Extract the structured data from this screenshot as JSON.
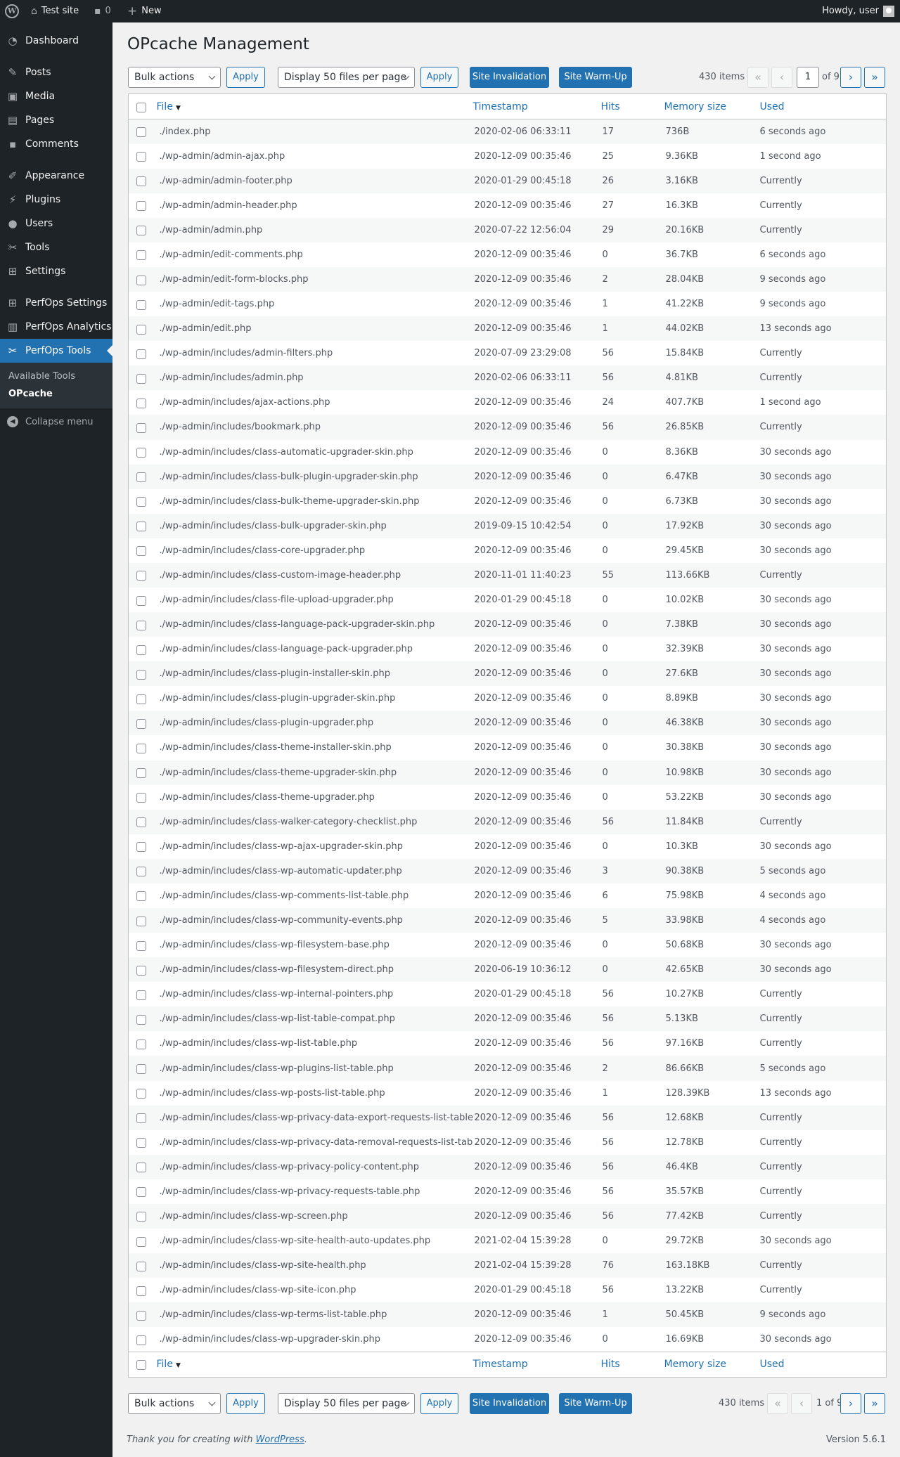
{
  "admin_bar": {
    "site_name": "Test site",
    "comments_count": "0",
    "new_label": "New",
    "howdy": "Howdy, user"
  },
  "sidebar": {
    "items": [
      {
        "label": "Dashboard",
        "icon": "dashboard-icon"
      },
      {
        "label": "Posts",
        "icon": "pin-icon"
      },
      {
        "label": "Media",
        "icon": "media-icon"
      },
      {
        "label": "Pages",
        "icon": "pages-icon"
      },
      {
        "label": "Comments",
        "icon": "comment-icon"
      },
      {
        "label": "Appearance",
        "icon": "brush-icon"
      },
      {
        "label": "Plugins",
        "icon": "plug-icon"
      },
      {
        "label": "Users",
        "icon": "user-icon"
      },
      {
        "label": "Tools",
        "icon": "wrench-icon"
      },
      {
        "label": "Settings",
        "icon": "settings-icon"
      },
      {
        "label": "PerfOps Settings",
        "icon": "settings-icon"
      },
      {
        "label": "PerfOps Analytics",
        "icon": "chart-icon"
      },
      {
        "label": "PerfOps Tools",
        "icon": "wrench-icon"
      }
    ],
    "submenu": [
      "Available Tools",
      "OPcache"
    ],
    "collapse": "Collapse menu"
  },
  "page": {
    "title": "OPcache Management"
  },
  "toolbar": {
    "bulk_actions": "Bulk actions",
    "apply": "Apply",
    "display": "Display 50 files per page",
    "site_invalidation": "Site Invalidation",
    "site_warmup": "Site Warm-Up",
    "items_count": "430 items",
    "current_page": "1",
    "of_pages": "of 9",
    "page_label_bottom": "1 of 9",
    "first": "«",
    "prev": "‹",
    "next": "›",
    "last": "»"
  },
  "columns": {
    "file": "File",
    "timestamp": "Timestamp",
    "hits": "Hits",
    "memory": "Memory size",
    "used": "Used"
  },
  "rows": [
    [
      "./index.php",
      "2020-02-06 06:33:11",
      "17",
      "736B",
      "6 seconds ago"
    ],
    [
      "./wp-admin/admin-ajax.php",
      "2020-12-09 00:35:46",
      "25",
      "9.36KB",
      "1 second ago"
    ],
    [
      "./wp-admin/admin-footer.php",
      "2020-01-29 00:45:18",
      "26",
      "3.16KB",
      "Currently"
    ],
    [
      "./wp-admin/admin-header.php",
      "2020-12-09 00:35:46",
      "27",
      "16.3KB",
      "Currently"
    ],
    [
      "./wp-admin/admin.php",
      "2020-07-22 12:56:04",
      "29",
      "20.16KB",
      "Currently"
    ],
    [
      "./wp-admin/edit-comments.php",
      "2020-12-09 00:35:46",
      "0",
      "36.7KB",
      "6 seconds ago"
    ],
    [
      "./wp-admin/edit-form-blocks.php",
      "2020-12-09 00:35:46",
      "2",
      "28.04KB",
      "9 seconds ago"
    ],
    [
      "./wp-admin/edit-tags.php",
      "2020-12-09 00:35:46",
      "1",
      "41.22KB",
      "9 seconds ago"
    ],
    [
      "./wp-admin/edit.php",
      "2020-12-09 00:35:46",
      "1",
      "44.02KB",
      "13 seconds ago"
    ],
    [
      "./wp-admin/includes/admin-filters.php",
      "2020-07-09 23:29:08",
      "56",
      "15.84KB",
      "Currently"
    ],
    [
      "./wp-admin/includes/admin.php",
      "2020-02-06 06:33:11",
      "56",
      "4.81KB",
      "Currently"
    ],
    [
      "./wp-admin/includes/ajax-actions.php",
      "2020-12-09 00:35:46",
      "24",
      "407.7KB",
      "1 second ago"
    ],
    [
      "./wp-admin/includes/bookmark.php",
      "2020-12-09 00:35:46",
      "56",
      "26.85KB",
      "Currently"
    ],
    [
      "./wp-admin/includes/class-automatic-upgrader-skin.php",
      "2020-12-09 00:35:46",
      "0",
      "8.36KB",
      "30 seconds ago"
    ],
    [
      "./wp-admin/includes/class-bulk-plugin-upgrader-skin.php",
      "2020-12-09 00:35:46",
      "0",
      "6.47KB",
      "30 seconds ago"
    ],
    [
      "./wp-admin/includes/class-bulk-theme-upgrader-skin.php",
      "2020-12-09 00:35:46",
      "0",
      "6.73KB",
      "30 seconds ago"
    ],
    [
      "./wp-admin/includes/class-bulk-upgrader-skin.php",
      "2019-09-15 10:42:54",
      "0",
      "17.92KB",
      "30 seconds ago"
    ],
    [
      "./wp-admin/includes/class-core-upgrader.php",
      "2020-12-09 00:35:46",
      "0",
      "29.45KB",
      "30 seconds ago"
    ],
    [
      "./wp-admin/includes/class-custom-image-header.php",
      "2020-11-01 11:40:23",
      "55",
      "113.66KB",
      "Currently"
    ],
    [
      "./wp-admin/includes/class-file-upload-upgrader.php",
      "2020-01-29 00:45:18",
      "0",
      "10.02KB",
      "30 seconds ago"
    ],
    [
      "./wp-admin/includes/class-language-pack-upgrader-skin.php",
      "2020-12-09 00:35:46",
      "0",
      "7.38KB",
      "30 seconds ago"
    ],
    [
      "./wp-admin/includes/class-language-pack-upgrader.php",
      "2020-12-09 00:35:46",
      "0",
      "32.39KB",
      "30 seconds ago"
    ],
    [
      "./wp-admin/includes/class-plugin-installer-skin.php",
      "2020-12-09 00:35:46",
      "0",
      "27.6KB",
      "30 seconds ago"
    ],
    [
      "./wp-admin/includes/class-plugin-upgrader-skin.php",
      "2020-12-09 00:35:46",
      "0",
      "8.89KB",
      "30 seconds ago"
    ],
    [
      "./wp-admin/includes/class-plugin-upgrader.php",
      "2020-12-09 00:35:46",
      "0",
      "46.38KB",
      "30 seconds ago"
    ],
    [
      "./wp-admin/includes/class-theme-installer-skin.php",
      "2020-12-09 00:35:46",
      "0",
      "30.38KB",
      "30 seconds ago"
    ],
    [
      "./wp-admin/includes/class-theme-upgrader-skin.php",
      "2020-12-09 00:35:46",
      "0",
      "10.98KB",
      "30 seconds ago"
    ],
    [
      "./wp-admin/includes/class-theme-upgrader.php",
      "2020-12-09 00:35:46",
      "0",
      "53.22KB",
      "30 seconds ago"
    ],
    [
      "./wp-admin/includes/class-walker-category-checklist.php",
      "2020-12-09 00:35:46",
      "56",
      "11.84KB",
      "Currently"
    ],
    [
      "./wp-admin/includes/class-wp-ajax-upgrader-skin.php",
      "2020-12-09 00:35:46",
      "0",
      "10.3KB",
      "30 seconds ago"
    ],
    [
      "./wp-admin/includes/class-wp-automatic-updater.php",
      "2020-12-09 00:35:46",
      "3",
      "90.38KB",
      "5 seconds ago"
    ],
    [
      "./wp-admin/includes/class-wp-comments-list-table.php",
      "2020-12-09 00:35:46",
      "6",
      "75.98KB",
      "4 seconds ago"
    ],
    [
      "./wp-admin/includes/class-wp-community-events.php",
      "2020-12-09 00:35:46",
      "5",
      "33.98KB",
      "4 seconds ago"
    ],
    [
      "./wp-admin/includes/class-wp-filesystem-base.php",
      "2020-12-09 00:35:46",
      "0",
      "50.68KB",
      "30 seconds ago"
    ],
    [
      "./wp-admin/includes/class-wp-filesystem-direct.php",
      "2020-06-19 10:36:12",
      "0",
      "42.65KB",
      "30 seconds ago"
    ],
    [
      "./wp-admin/includes/class-wp-internal-pointers.php",
      "2020-01-29 00:45:18",
      "56",
      "10.27KB",
      "Currently"
    ],
    [
      "./wp-admin/includes/class-wp-list-table-compat.php",
      "2020-12-09 00:35:46",
      "56",
      "5.13KB",
      "Currently"
    ],
    [
      "./wp-admin/includes/class-wp-list-table.php",
      "2020-12-09 00:35:46",
      "56",
      "97.16KB",
      "Currently"
    ],
    [
      "./wp-admin/includes/class-wp-plugins-list-table.php",
      "2020-12-09 00:35:46",
      "2",
      "86.66KB",
      "5 seconds ago"
    ],
    [
      "./wp-admin/includes/class-wp-posts-list-table.php",
      "2020-12-09 00:35:46",
      "1",
      "128.39KB",
      "13 seconds ago"
    ],
    [
      "./wp-admin/includes/class-wp-privacy-data-export-requests-list-table.php",
      "2020-12-09 00:35:46",
      "56",
      "12.68KB",
      "Currently"
    ],
    [
      "./wp-admin/includes/class-wp-privacy-data-removal-requests-list-table.php",
      "2020-12-09 00:35:46",
      "56",
      "12.78KB",
      "Currently"
    ],
    [
      "./wp-admin/includes/class-wp-privacy-policy-content.php",
      "2020-12-09 00:35:46",
      "56",
      "46.4KB",
      "Currently"
    ],
    [
      "./wp-admin/includes/class-wp-privacy-requests-table.php",
      "2020-12-09 00:35:46",
      "56",
      "35.57KB",
      "Currently"
    ],
    [
      "./wp-admin/includes/class-wp-screen.php",
      "2020-12-09 00:35:46",
      "56",
      "77.42KB",
      "Currently"
    ],
    [
      "./wp-admin/includes/class-wp-site-health-auto-updates.php",
      "2021-02-04 15:39:28",
      "0",
      "29.72KB",
      "30 seconds ago"
    ],
    [
      "./wp-admin/includes/class-wp-site-health.php",
      "2021-02-04 15:39:28",
      "76",
      "163.18KB",
      "Currently"
    ],
    [
      "./wp-admin/includes/class-wp-site-icon.php",
      "2020-01-29 00:45:18",
      "56",
      "13.22KB",
      "Currently"
    ],
    [
      "./wp-admin/includes/class-wp-terms-list-table.php",
      "2020-12-09 00:35:46",
      "1",
      "50.45KB",
      "9 seconds ago"
    ],
    [
      "./wp-admin/includes/class-wp-upgrader-skin.php",
      "2020-12-09 00:35:46",
      "0",
      "16.69KB",
      "30 seconds ago"
    ]
  ],
  "footer": {
    "thanks_prefix": "Thank you for creating with ",
    "wordpress_link": "WordPress",
    "thanks_suffix": ".",
    "version": "Version 5.6.1"
  }
}
